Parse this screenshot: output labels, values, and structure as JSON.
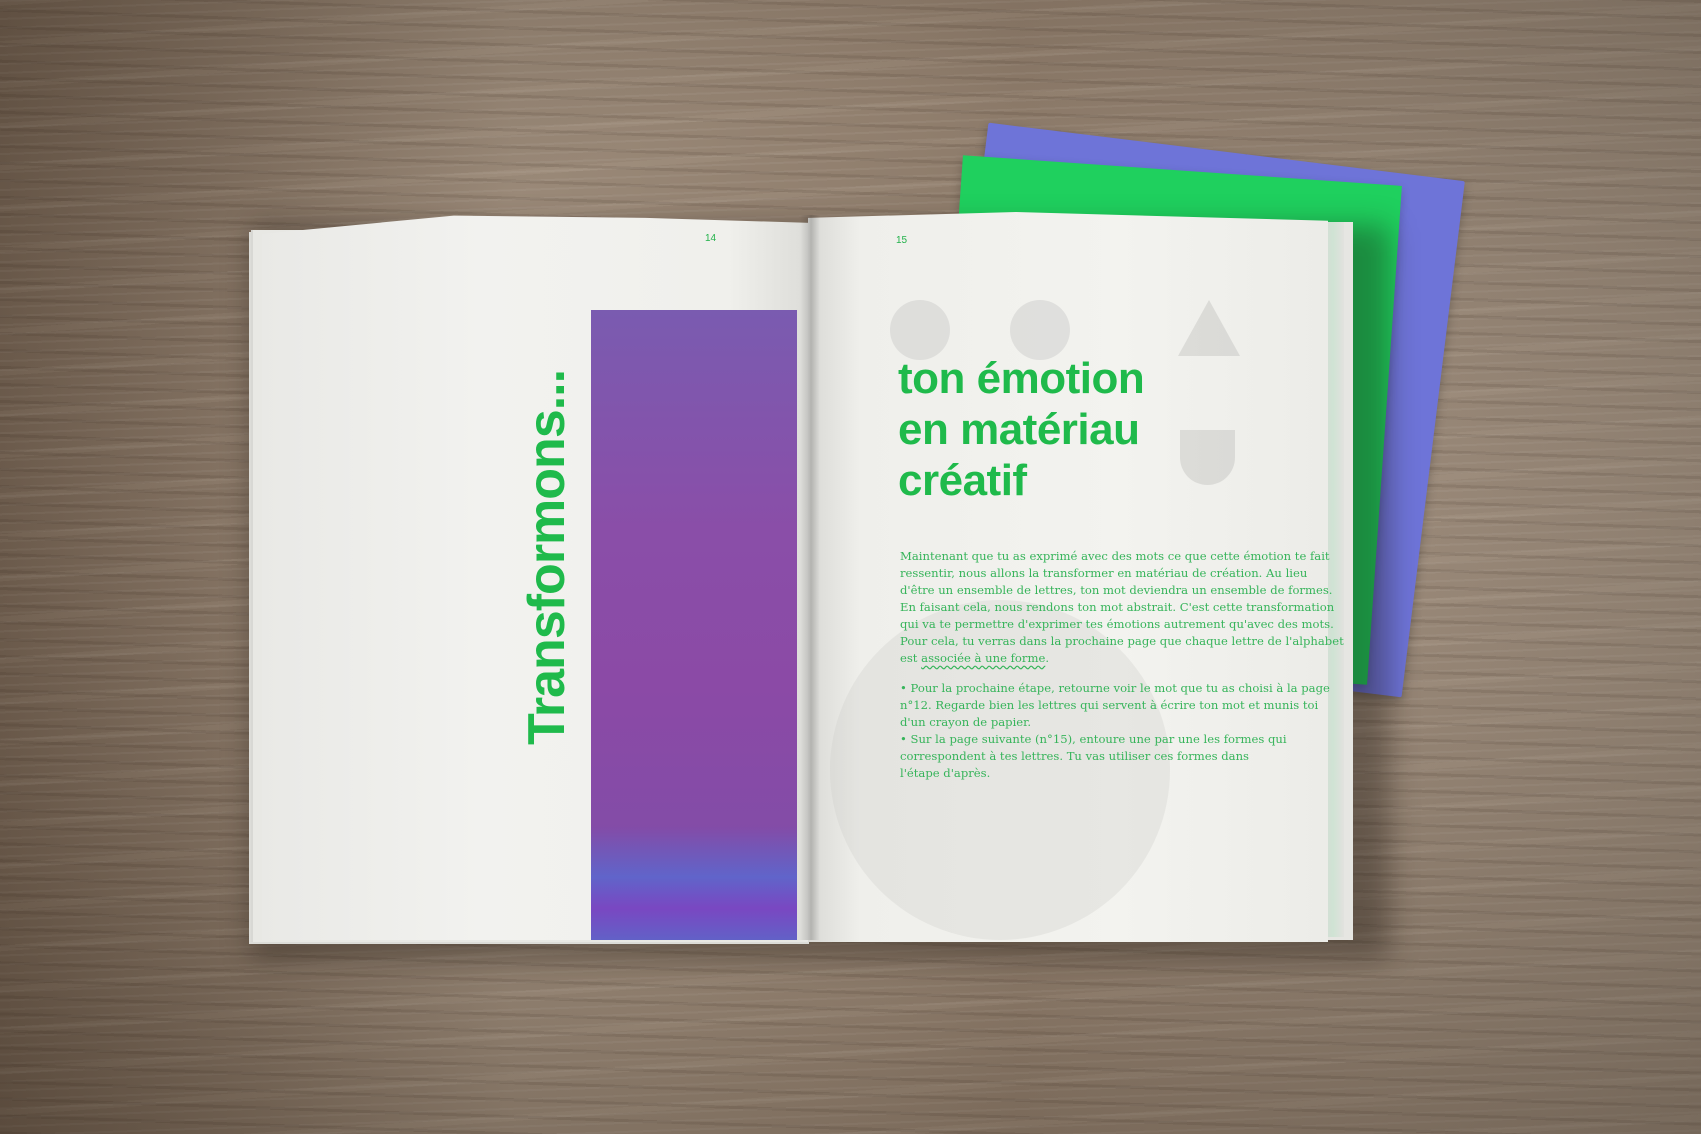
{
  "scene": {
    "colors": {
      "accent_green": "#1fba4b",
      "purple_block": "#8b4aa6",
      "cover_blue": "#6e74d8",
      "cover_green": "#1fd05e",
      "table_wood": "#8a7866"
    }
  },
  "left_page": {
    "page_number": "14",
    "vertical_title": "Transformons..."
  },
  "right_page": {
    "page_number": "15",
    "headline": [
      "ton émotion",
      "en matériau",
      "créatif"
    ],
    "body_lines": [
      "Maintenant que tu as exprimé avec des mots ce que cette émotion te fait",
      "ressentir, nous allons la transformer en matériau de création. Au lieu",
      "d'être un ensemble de lettres, ton mot deviendra un ensemble de formes.",
      "En faisant cela, nous rendons ton mot abstrait. C'est cette transformation",
      "qui va te permettre d'exprimer tes émotions autrement qu'avec des mots.",
      "Pour cela, tu verras dans la prochaine page que chaque lettre de l'alphabet"
    ],
    "body_last_prefix": "est ",
    "body_last_underlined": "associée à une forme",
    "body_last_suffix": ".",
    "steps_lines": [
      "• Pour la prochaine étape, retourne voir le mot que tu as choisi à la page",
      "n°12. Regarde bien les lettres qui servent à écrire ton mot et munis toi",
      "d'un crayon de papier.",
      "• Sur la page suivante (n°15), entoure une par une les formes qui",
      "correspondent à tes lettres. Tu vas utiliser ces formes dans",
      "l'étape d'après."
    ]
  }
}
